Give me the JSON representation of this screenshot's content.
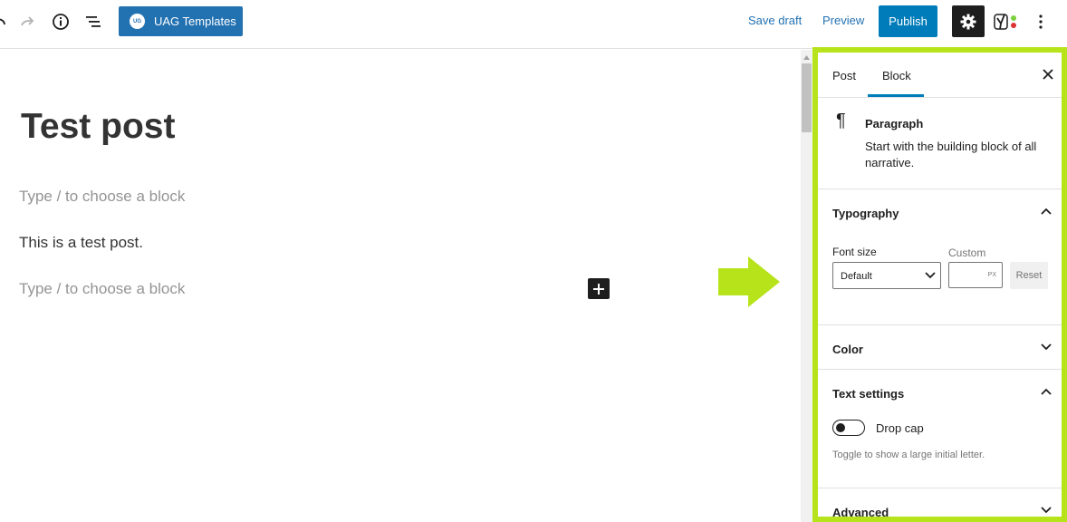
{
  "toolbar": {
    "uag_badge": "UG",
    "uag_label": "UAG Templates",
    "save_draft": "Save draft",
    "preview": "Preview",
    "publish": "Publish",
    "icons": [
      "undo-icon",
      "redo-icon",
      "info-icon",
      "list-view-icon",
      "gear-icon",
      "yoast-icon",
      "more-vertical-icon"
    ]
  },
  "editor": {
    "title": "Test post",
    "placeholder_1": "Type / to choose a block",
    "paragraph": "This is a test post.",
    "placeholder_2": "Type / to choose a block"
  },
  "sidebar": {
    "tabs": [
      {
        "label": "Post",
        "active": false
      },
      {
        "label": "Block",
        "active": true
      }
    ],
    "block_card": {
      "icon": "pilcrow-icon",
      "name": "Paragraph",
      "description": "Start with the building block of all narrative."
    },
    "typography": {
      "title": "Typography",
      "font_size_label": "Font size",
      "custom_label": "Custom",
      "select_value": "Default",
      "unit": "PX",
      "reset_label": "Reset"
    },
    "color": {
      "title": "Color"
    },
    "text_settings": {
      "title": "Text settings",
      "drop_cap_label": "Drop cap",
      "drop_cap_on": false,
      "help": "Toggle to show a large initial letter."
    },
    "advanced": {
      "title": "Advanced"
    }
  },
  "colors": {
    "accent": "#007cba",
    "uag_blue": "#2271b1",
    "highlight": "#b7e31b",
    "dark": "#1e1e1e"
  }
}
